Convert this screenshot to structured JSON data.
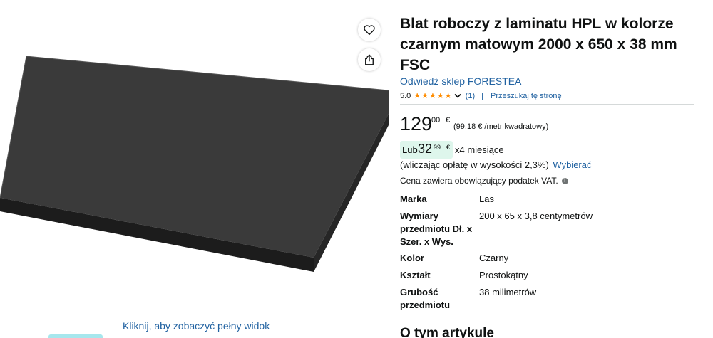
{
  "gallery": {
    "full_view_link": "Kliknij, aby zobaczyć pełny widok",
    "wishlist_icon": "heart-icon",
    "share_icon": "share-icon"
  },
  "product": {
    "title": "Blat roboczy z laminatu HPL w kolorze czarnym matowym 2000 x 650 x 38 mm FSC",
    "store_link": "Odwiedź sklep FORESTEA",
    "rating": {
      "value": "5.0",
      "stars": 5,
      "star_color": "#ff8c00",
      "count": "(1)",
      "separator": "|",
      "search_page": "Przeszukaj tę stronę"
    }
  },
  "price": {
    "whole": "129",
    "fraction": "00",
    "currency": "€",
    "unit_price": "(99,18 € /metr kwadratowy)"
  },
  "installment": {
    "prefix": "Lub",
    "whole": "32",
    "fraction": "99",
    "currency": "€",
    "suffix": "x4 miesiące",
    "badge_color": "#def6ec",
    "fee_text": "(wliczając opłatę w wysokości 2,3%)",
    "choose_link": "Wybierać"
  },
  "vat_text": "Cena zawiera obowiązujący podatek VAT.",
  "specs": [
    {
      "label": "Marka",
      "value": "Las"
    },
    {
      "label": "Wymiary przedmiotu Dł. x Szer. x Wys.",
      "value": "200 x 65 x 3,8 centymetrów"
    },
    {
      "label": "Kolor",
      "value": "Czarny"
    },
    {
      "label": "Kształt",
      "value": "Prostokątny"
    },
    {
      "label": "Grubość przedmiotu",
      "value": "38 milimetrów"
    }
  ],
  "about_heading": "O tym artykule",
  "colors": {
    "link": "#2162a1",
    "text": "#0f1111",
    "divider": "#d5d9d9"
  }
}
